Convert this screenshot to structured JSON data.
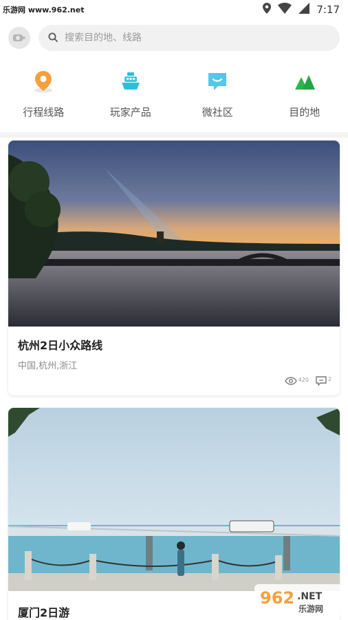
{
  "status_bar": {
    "watermark_site": "乐游网 www.962.net",
    "time": "7:17"
  },
  "search": {
    "placeholder": "搜索目的地、线路"
  },
  "categories": [
    {
      "label": "行程线路",
      "icon": "location-pin-icon"
    },
    {
      "label": "玩家产品",
      "icon": "ship-icon"
    },
    {
      "label": "微社区",
      "icon": "chat-bubble-icon"
    },
    {
      "label": "目的地",
      "icon": "mountain-icon"
    }
  ],
  "cards": [
    {
      "title": "杭州2日小众路线",
      "subtitle": "中国,杭州,浙江",
      "views": "420",
      "comments": "2"
    },
    {
      "title": "厦门2日游"
    }
  ],
  "watermark_logo": {
    "number": "962",
    "suffix": ".NET",
    "text": "乐游网"
  },
  "colors": {
    "accent_orange": "#f5a03a",
    "teal": "#2cbfd8",
    "green": "#2fb54a"
  }
}
